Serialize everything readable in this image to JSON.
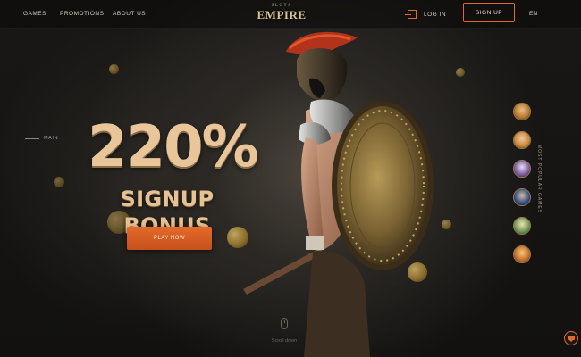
{
  "brand": {
    "top": "SLOTS",
    "name": "EMPIRE"
  },
  "nav": {
    "games": "GAMES",
    "promotions": "PROMOTIONS",
    "about": "ABOUT US",
    "login": "LOG IN",
    "signup": "SIGN UP",
    "language": "EN"
  },
  "side": {
    "main_label": "MAIN"
  },
  "hero": {
    "percent": "220%",
    "bonus": "SIGNUP BONUS",
    "play": "PLAY NOW"
  },
  "games_rail": {
    "label": "MOST POPULAR GAMES",
    "items": [
      {
        "icon": "game-thumb-icon",
        "color": "#b7772e"
      },
      {
        "icon": "game-thumb-icon",
        "color": "#c9873a"
      },
      {
        "icon": "game-thumb-icon",
        "color": "#7b5aa1"
      },
      {
        "icon": "game-thumb-icon",
        "color": "#2f4e8a"
      },
      {
        "icon": "game-thumb-icon",
        "color": "#6c9a56"
      },
      {
        "icon": "game-thumb-icon",
        "color": "#c86b2a"
      }
    ]
  },
  "scroll": {
    "label": "Scroll down"
  },
  "colors": {
    "accent": "#e06a2b",
    "gold": "#e8c69a"
  }
}
